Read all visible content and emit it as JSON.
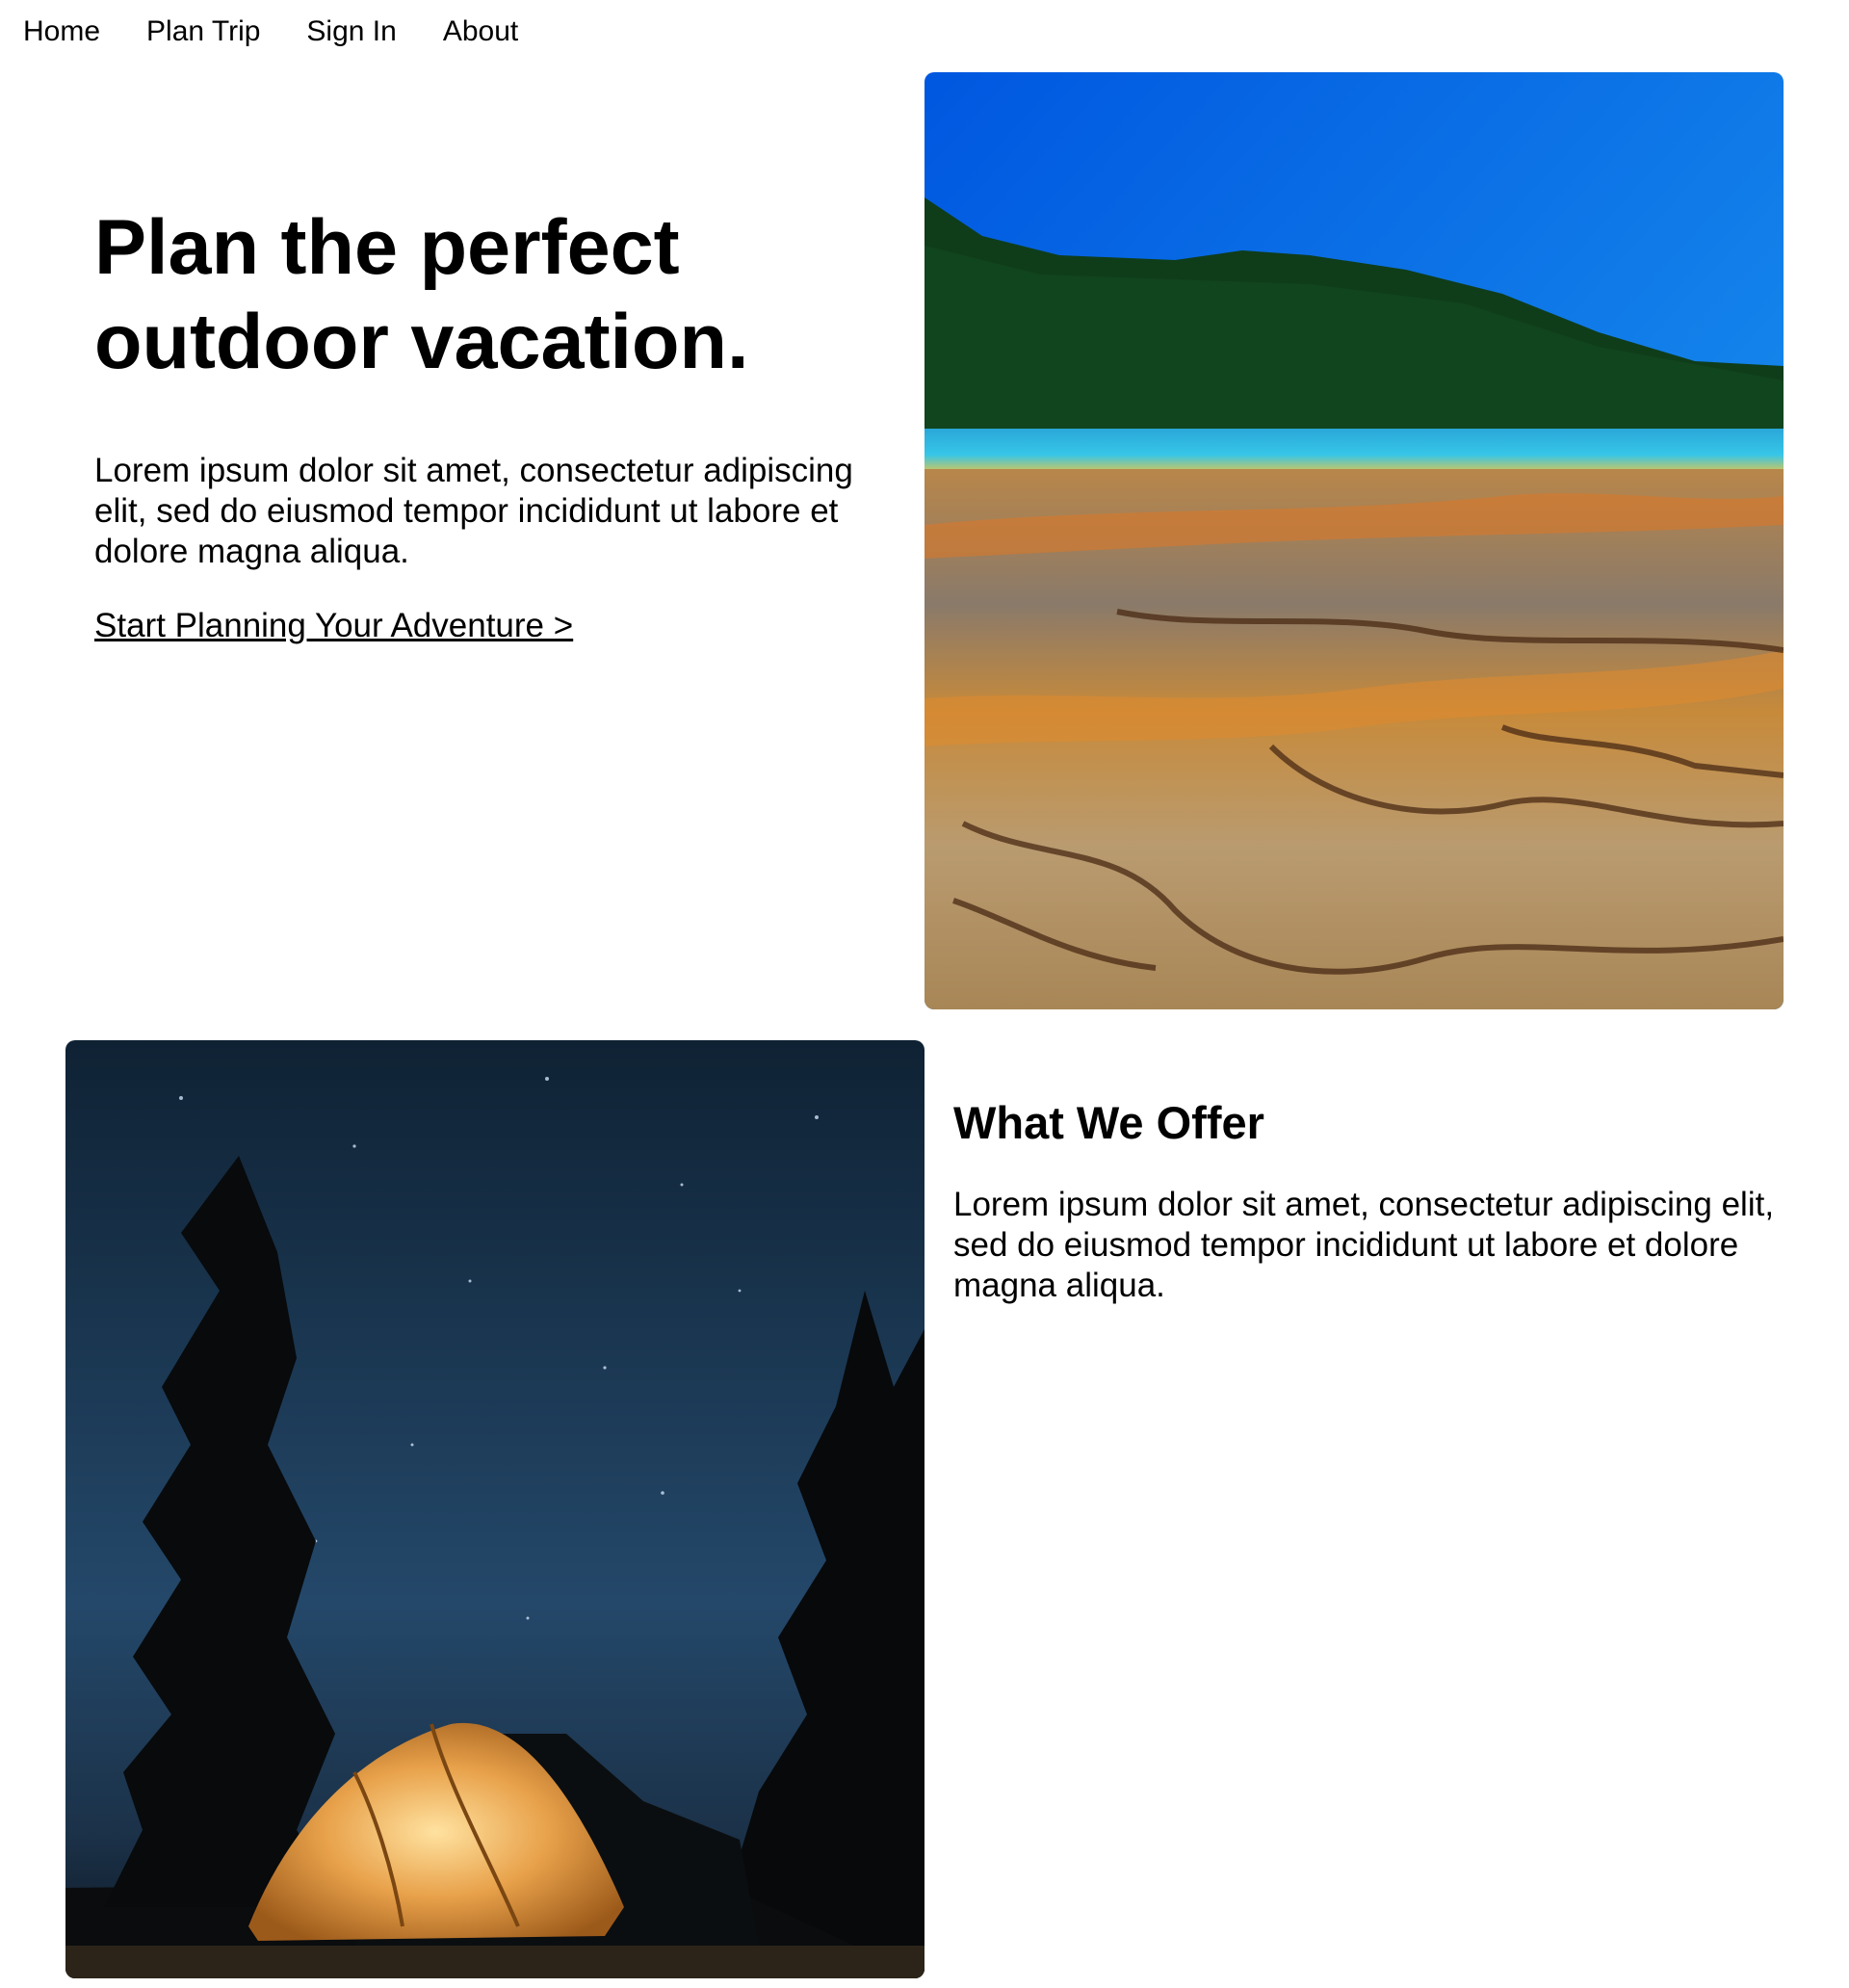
{
  "nav": {
    "items": [
      "Home",
      "Plan Trip",
      "Sign In",
      "About"
    ]
  },
  "hero": {
    "title_line1": "Plan the perfect",
    "title_line2": "outdoor vacation.",
    "body": "Lorem ipsum dolor sit amet, consectetur adipiscing elit, sed do eiusmod tempor incididunt ut labore et dolore magna aliqua.",
    "cta": "Start Planning Your Adventure >"
  },
  "offer": {
    "title": "What We Offer",
    "body": "Lorem ipsum dolor sit amet, consectetur adipiscing elit, sed do eiusmod tempor incididunt ut labore et dolore magna aliqua."
  },
  "colors": {
    "text": "#000000",
    "background": "#ffffff"
  }
}
